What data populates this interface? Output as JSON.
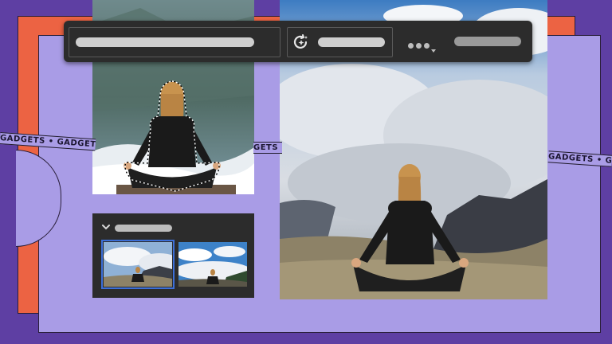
{
  "tape": {
    "text_left": "GADGETS • GADGETS • G",
    "text_mid": "GETS",
    "text_right": "GADGETS • GAD"
  },
  "toolbar": {
    "prompt_placeholder": "",
    "generate_label": "",
    "more_label": ""
  },
  "panel": {
    "title": "",
    "selected_thumbnail_index": 0
  },
  "icons": [
    "generative-fill-icon",
    "more-options-icon",
    "chevron-down-icon"
  ],
  "colors": {
    "background": "#5e3fa3",
    "orange": "#ec6343",
    "lavender": "#a99ce6",
    "toolbar": "#2c2c2c",
    "selection_blue": "#3c6fd8"
  }
}
